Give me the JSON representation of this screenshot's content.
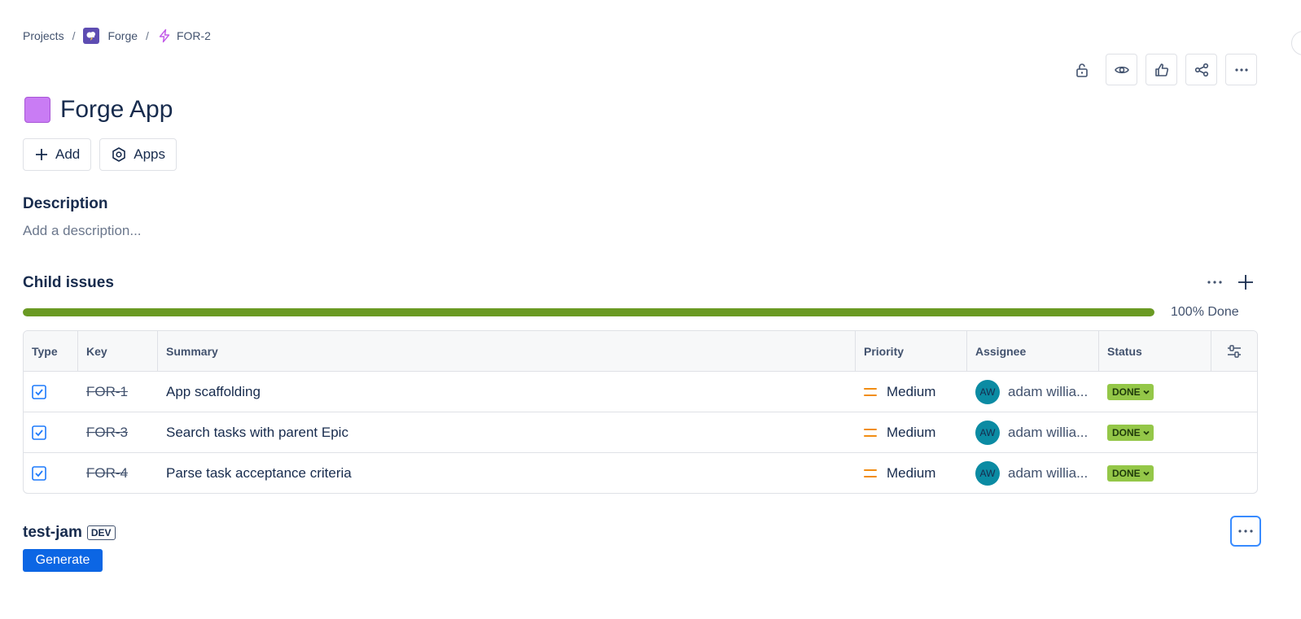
{
  "breadcrumb": {
    "projects": "Projects",
    "separator": "/",
    "project": "Forge",
    "issue_key": "FOR-2"
  },
  "toolbar": {
    "icons": [
      "unlock-icon",
      "eye-icon",
      "thumbs-up-icon",
      "share-icon",
      "more-icon"
    ]
  },
  "issue": {
    "title": "Forge App",
    "swatch_color": "#c97cf4"
  },
  "actions": {
    "add_label": "Add",
    "apps_label": "Apps"
  },
  "description": {
    "heading": "Description",
    "placeholder": "Add a description..."
  },
  "child_issues": {
    "heading": "Child issues",
    "progress_percent": 100,
    "progress_label": "100% Done",
    "columns": [
      "Type",
      "Key",
      "Summary",
      "Priority",
      "Assignee",
      "Status"
    ],
    "rows": [
      {
        "key": "FOR-1",
        "summary": "App scaffolding",
        "priority": "Medium",
        "assignee_initials": "AW",
        "assignee": "adam willia...",
        "status": "DONE"
      },
      {
        "key": "FOR-3",
        "summary": "Search tasks with parent Epic",
        "priority": "Medium",
        "assignee_initials": "AW",
        "assignee": "adam willia...",
        "status": "DONE"
      },
      {
        "key": "FOR-4",
        "summary": "Parse task acceptance criteria",
        "priority": "Medium",
        "assignee_initials": "AW",
        "assignee": "adam willia...",
        "status": "DONE"
      }
    ]
  },
  "app_panel": {
    "name": "test-jam",
    "badge": "DEV",
    "button_label": "Generate"
  },
  "colors": {
    "progress": "#6a9a23",
    "priority_medium": "#f18d13",
    "status_done": "#94c748",
    "primary_button": "#0c66e4"
  }
}
